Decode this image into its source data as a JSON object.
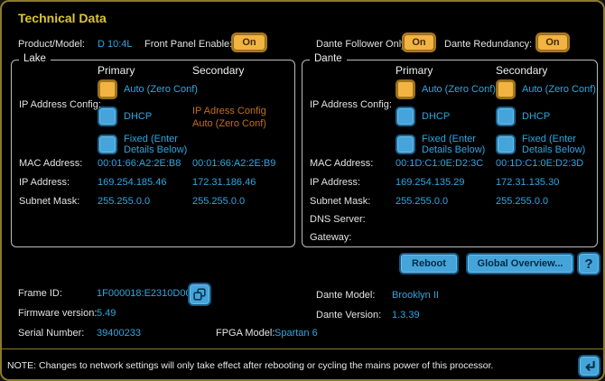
{
  "window": {
    "title": "Technical Data",
    "colors": {
      "accent_yellow": "#dcc72f",
      "accent_orange": "#f1b442",
      "accent_blue": "#45a4da",
      "value_blue": "#2ea7e0",
      "note_orange": "#c0701d",
      "frame_olive": "#8a7b2e"
    }
  },
  "header": {
    "product_model_label": "Product/Model:",
    "product_model_value": "D 10:4L",
    "front_panel_enable_label": "Front Panel Enable:",
    "front_panel_enable_value": "On",
    "dante_follower_label": "Dante Follower Only:",
    "dante_follower_value": "On",
    "dante_redundancy_label": "Dante Redundancy:",
    "dante_redundancy_value": "On"
  },
  "lake": {
    "title": "Lake",
    "primary_header": "Primary",
    "secondary_header": "Secondary",
    "ip_config_label": "IP Address Config:",
    "options": {
      "auto": "Auto (Zero Conf)",
      "dhcp": "DHCP",
      "fixed": "Fixed (Enter\nDetails Below)"
    },
    "secondary_note": "IP Adress Config\nAuto (Zero Conf)",
    "rows": [
      {
        "label": "MAC Address:",
        "primary": "00:01:66:A2:2E:B8",
        "secondary": "00:01:66:A2:2E:B9"
      },
      {
        "label": "IP Address:",
        "primary": "169.254.185.46",
        "secondary": "172.31.186.46"
      },
      {
        "label": "Subnet Mask:",
        "primary": "255.255.0.0",
        "secondary": "255.255.0.0"
      }
    ]
  },
  "dante": {
    "title": "Dante",
    "primary_header": "Primary",
    "secondary_header": "Secondary",
    "ip_config_label": "IP Address Config:",
    "options": {
      "auto": "Auto (Zero Conf)",
      "dhcp": "DHCP",
      "fixed": "Fixed (Enter\nDetails Below)"
    },
    "rows": [
      {
        "label": "MAC Address:",
        "primary": "00:1D:C1:0E:D2:3C",
        "secondary": "00:1D:C1:0E:D2:3D"
      },
      {
        "label": "IP Address:",
        "primary": "169.254.135.29",
        "secondary": "172.31.135.30"
      },
      {
        "label": "Subnet Mask:",
        "primary": "255.255.0.0",
        "secondary": "255.255.0.0"
      },
      {
        "label": "DNS Server:",
        "primary": "",
        "secondary": ""
      },
      {
        "label": "Gateway:",
        "primary": "",
        "secondary": ""
      }
    ]
  },
  "actions": {
    "reboot_label": "Reboot",
    "global_overview_label": "Global Overview...",
    "help_label": "?"
  },
  "info": {
    "frame_id_label": "Frame ID:",
    "frame_id_value": "1F000018:E2310D00",
    "firmware_label": "Firmware version:",
    "firmware_value": "5.49",
    "serial_label": "Serial Number:",
    "serial_value": "39400233",
    "fpga_label": "FPGA Model:",
    "fpga_value": "Spartan 6",
    "dante_model_label": "Dante Model:",
    "dante_model_value": "Brooklyn II",
    "dante_version_label": "Dante Version:",
    "dante_version_value": "1.3.39"
  },
  "footer": {
    "note": "NOTE: Changes to network settings will only take effect after rebooting or cycling the mains power of this processor."
  }
}
